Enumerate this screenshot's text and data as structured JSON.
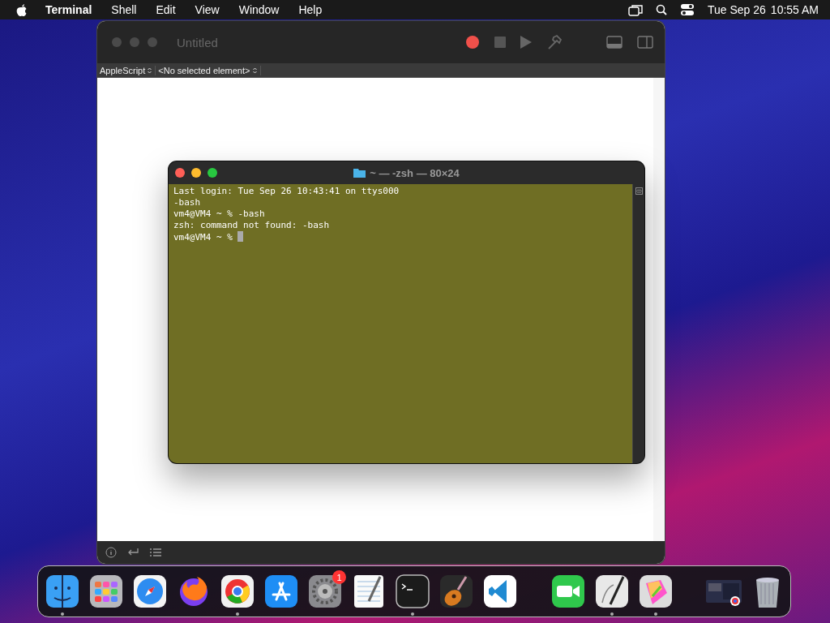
{
  "menu_bar": {
    "app_name": "Terminal",
    "menus": [
      "Shell",
      "Edit",
      "View",
      "Window",
      "Help"
    ],
    "date": "Tue Sep 26",
    "time": "10:55 AM"
  },
  "script_editor": {
    "title": "Untitled",
    "language": "AppleScript",
    "element": "<No selected element>",
    "recording": true
  },
  "terminal": {
    "title": "~ — -zsh — 80×24",
    "lines": [
      "Last login: Tue Sep 26 10:43:41 on ttys000",
      "-bash",
      "vm4@VM4 ~ % -bash",
      "zsh: command not found: -bash",
      "vm4@VM4 ~ % "
    ]
  },
  "dock": {
    "items": [
      {
        "kind": "finder",
        "running": true
      },
      {
        "kind": "launchpad",
        "running": false
      },
      {
        "kind": "safari",
        "running": false
      },
      {
        "kind": "firefox",
        "running": false
      },
      {
        "kind": "chrome",
        "running": true
      },
      {
        "kind": "appstore",
        "running": false
      },
      {
        "kind": "settings",
        "running": false,
        "badge": "1"
      },
      {
        "kind": "textedit",
        "running": false
      },
      {
        "kind": "terminal",
        "running": true
      },
      {
        "kind": "garageband",
        "running": false
      },
      {
        "kind": "vscode",
        "running": false
      },
      {
        "kind": "separator"
      },
      {
        "kind": "facetime",
        "running": false
      },
      {
        "kind": "scripteditor",
        "running": true
      },
      {
        "kind": "freeform",
        "running": true
      },
      {
        "kind": "separator"
      },
      {
        "kind": "window",
        "running": false
      },
      {
        "kind": "trash",
        "running": false
      }
    ]
  }
}
